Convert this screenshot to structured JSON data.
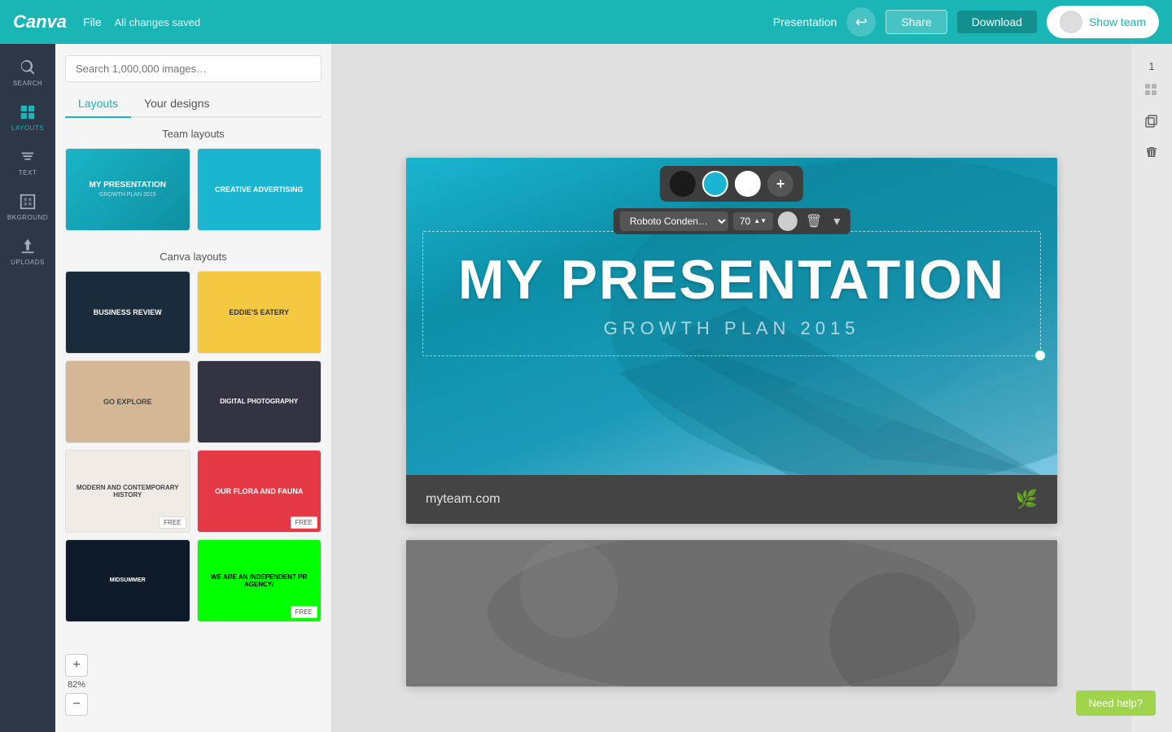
{
  "app": {
    "name": "Canva",
    "saved_status": "All changes saved"
  },
  "header": {
    "file_label": "File",
    "presentation_label": "Presentation",
    "share_label": "Share",
    "download_label": "Download",
    "show_team_label": "Show team",
    "undo_icon": "↩"
  },
  "sidebar_icons": [
    {
      "id": "search",
      "label": "SEARCH",
      "active": false
    },
    {
      "id": "layouts",
      "label": "LAYOUTS",
      "active": true
    },
    {
      "id": "text",
      "label": "TEXT",
      "active": false
    },
    {
      "id": "background",
      "label": "BKGROUND",
      "active": false
    },
    {
      "id": "uploads",
      "label": "UPLOADS",
      "active": false
    }
  ],
  "panel": {
    "search_placeholder": "Search 1,000,000 images…",
    "tabs": [
      {
        "label": "Layouts",
        "active": true
      },
      {
        "label": "Your designs",
        "active": false
      }
    ],
    "team_layouts_title": "Team layouts",
    "canva_layouts_title": "Canva layouts",
    "team_cards": [
      {
        "id": "my-presentation",
        "title": "MY PRESENTATION",
        "subtitle": "GROWTH PLAN 2015"
      },
      {
        "id": "creative-advertising",
        "title": "CREATIVE ADVERTISING"
      }
    ],
    "canva_cards": [
      {
        "id": "business-review",
        "title": "BUSINESS REVIEW",
        "badge": ""
      },
      {
        "id": "eddies-eatery",
        "title": "EDDIE'S EATERY",
        "badge": ""
      },
      {
        "id": "go-explore",
        "title": "GO EXPLORE",
        "badge": ""
      },
      {
        "id": "digital-photography",
        "title": "DIGITAL PHOTOGRAPHY",
        "badge": ""
      },
      {
        "id": "modern-history",
        "title": "MODERN AND CONTEMPORARY HISTORY",
        "badge": "FREE"
      },
      {
        "id": "flora-fauna",
        "title": "OUR FLORA AND FAUNA",
        "badge": "FREE"
      },
      {
        "id": "midsummer",
        "title": "MIDSUMMER",
        "badge": ""
      },
      {
        "id": "pr-agency",
        "title": "WE ARE AN INDEPENDENT PR AGENCY/",
        "badge": "FREE"
      }
    ]
  },
  "text_toolbar": {
    "font_name": "Roboto Conden…",
    "font_size": "70",
    "colors": [
      "#1a1a1a",
      "#1ab5d0",
      "#ffffff"
    ],
    "add_color_label": "+",
    "delete_icon": "🗑",
    "dropdown_icon": "▾"
  },
  "canvas": {
    "slide1": {
      "main_title": "MY PRESENTATION",
      "subtitle": "GROWTH PLAN 2015",
      "footer_url": "myteam.com",
      "footer_logo": "🌿"
    }
  },
  "right_toolbar": {
    "slide_number": "1"
  },
  "zoom": {
    "value": "82%",
    "plus_label": "+",
    "minus_label": "−"
  },
  "help": {
    "label": "Need help?"
  }
}
